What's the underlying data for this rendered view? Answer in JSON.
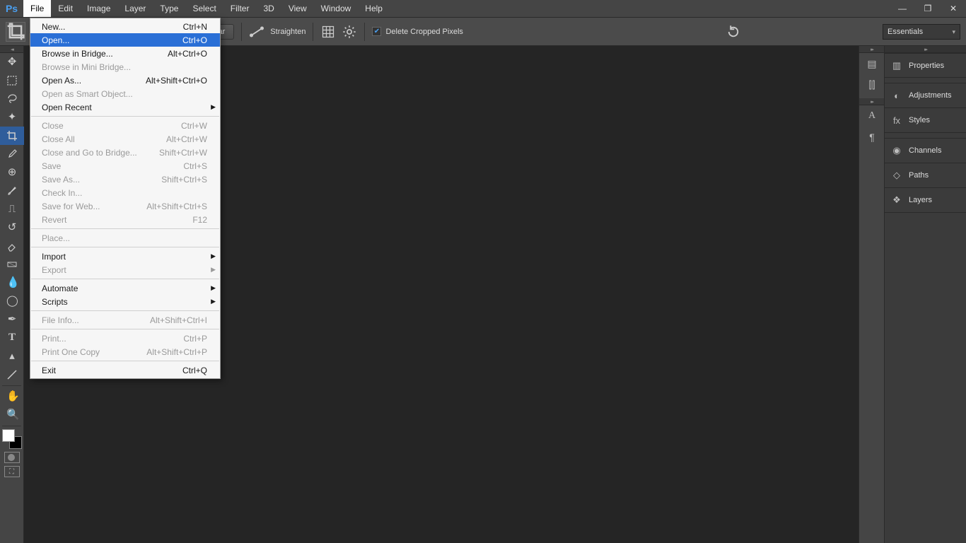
{
  "menubar": {
    "items": [
      "File",
      "Edit",
      "Image",
      "Layer",
      "Type",
      "Select",
      "Filter",
      "3D",
      "View",
      "Window",
      "Help"
    ],
    "active_index": 0
  },
  "optionsbar": {
    "clear_label": "Clear",
    "straighten_label": "Straighten",
    "delete_cropped_label": "Delete Cropped Pixels",
    "workspace": "Essentials"
  },
  "file_menu": [
    {
      "label": "New...",
      "shortcut": "Ctrl+N",
      "enabled": true
    },
    {
      "label": "Open...",
      "shortcut": "Ctrl+O",
      "enabled": true,
      "hover": true
    },
    {
      "label": "Browse in Bridge...",
      "shortcut": "Alt+Ctrl+O",
      "enabled": true
    },
    {
      "label": "Browse in Mini Bridge...",
      "shortcut": "",
      "enabled": false
    },
    {
      "label": "Open As...",
      "shortcut": "Alt+Shift+Ctrl+O",
      "enabled": true
    },
    {
      "label": "Open as Smart Object...",
      "shortcut": "",
      "enabled": false
    },
    {
      "label": "Open Recent",
      "shortcut": "",
      "enabled": true,
      "submenu": true
    },
    {
      "sep": true
    },
    {
      "label": "Close",
      "shortcut": "Ctrl+W",
      "enabled": false
    },
    {
      "label": "Close All",
      "shortcut": "Alt+Ctrl+W",
      "enabled": false
    },
    {
      "label": "Close and Go to Bridge...",
      "shortcut": "Shift+Ctrl+W",
      "enabled": false
    },
    {
      "label": "Save",
      "shortcut": "Ctrl+S",
      "enabled": false
    },
    {
      "label": "Save As...",
      "shortcut": "Shift+Ctrl+S",
      "enabled": false
    },
    {
      "label": "Check In...",
      "shortcut": "",
      "enabled": false
    },
    {
      "label": "Save for Web...",
      "shortcut": "Alt+Shift+Ctrl+S",
      "enabled": false
    },
    {
      "label": "Revert",
      "shortcut": "F12",
      "enabled": false
    },
    {
      "sep": true
    },
    {
      "label": "Place...",
      "shortcut": "",
      "enabled": false
    },
    {
      "sep": true
    },
    {
      "label": "Import",
      "shortcut": "",
      "enabled": true,
      "submenu": true
    },
    {
      "label": "Export",
      "shortcut": "",
      "enabled": false,
      "submenu": true
    },
    {
      "sep": true
    },
    {
      "label": "Automate",
      "shortcut": "",
      "enabled": true,
      "submenu": true
    },
    {
      "label": "Scripts",
      "shortcut": "",
      "enabled": true,
      "submenu": true
    },
    {
      "sep": true
    },
    {
      "label": "File Info...",
      "shortcut": "Alt+Shift+Ctrl+I",
      "enabled": false
    },
    {
      "sep": true
    },
    {
      "label": "Print...",
      "shortcut": "Ctrl+P",
      "enabled": false
    },
    {
      "label": "Print One Copy",
      "shortcut": "Alt+Shift+Ctrl+P",
      "enabled": false
    },
    {
      "sep": true
    },
    {
      "label": "Exit",
      "shortcut": "Ctrl+Q",
      "enabled": true
    }
  ],
  "panels": {
    "p0": "Properties",
    "p1": "Adjustments",
    "p2": "Styles",
    "p3": "Channels",
    "p4": "Paths",
    "p5": "Layers"
  }
}
